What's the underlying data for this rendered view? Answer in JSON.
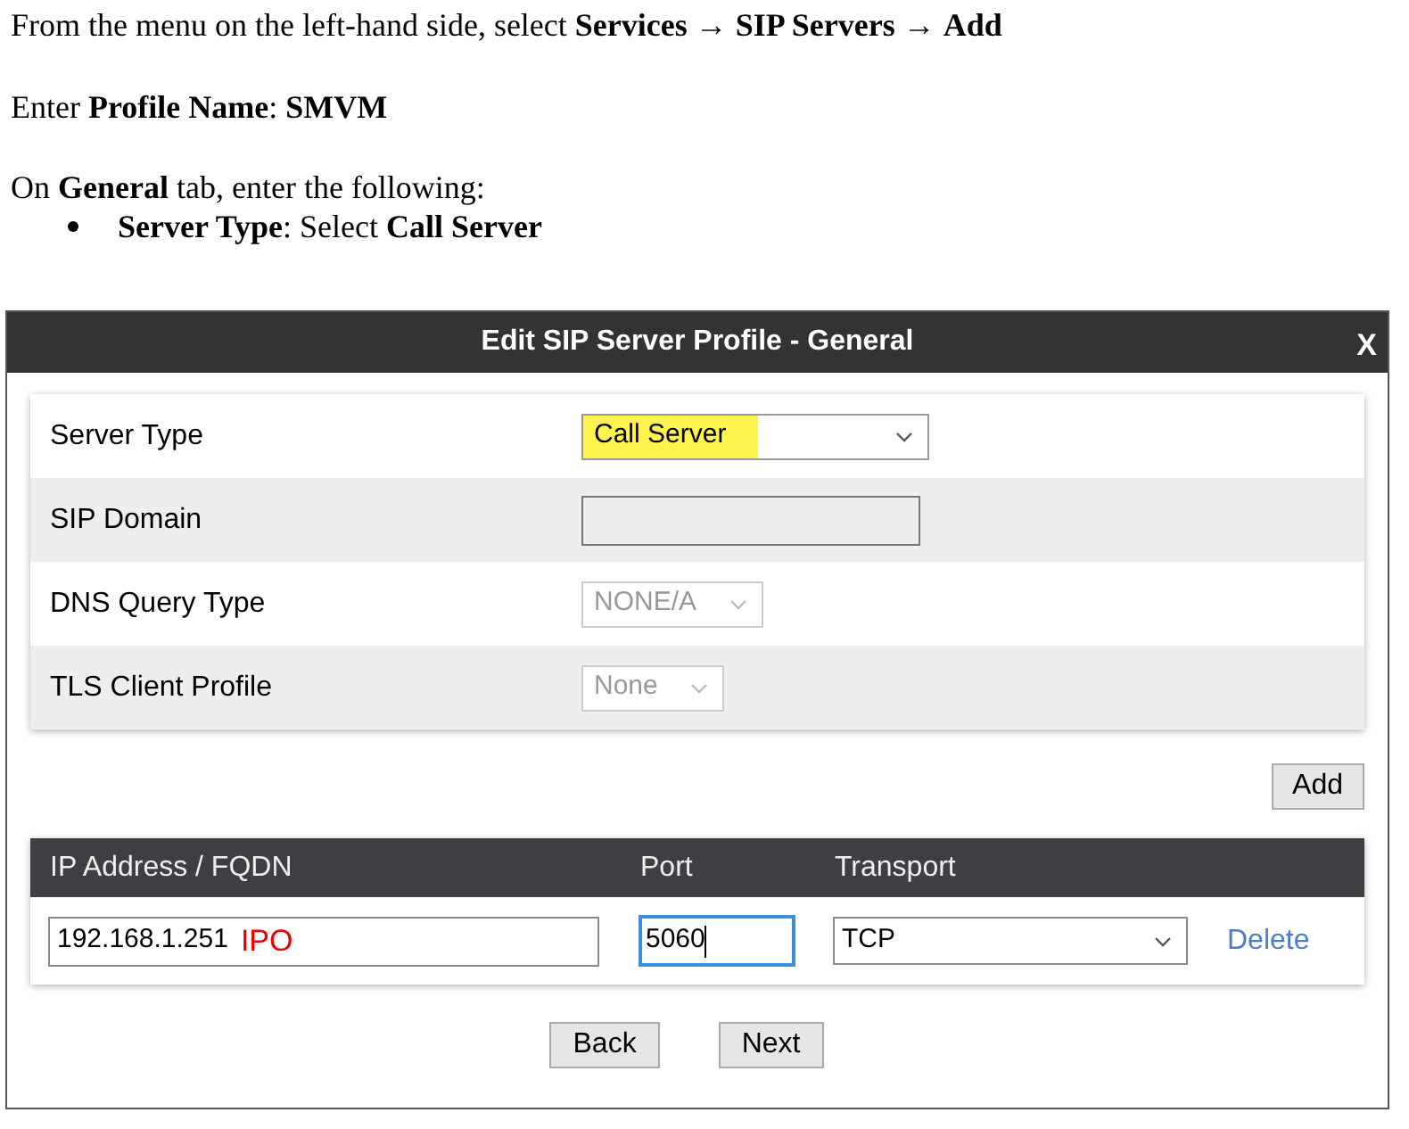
{
  "instructions": [
    "From the menu on the left-hand side, select **Services →** **SIP Servers →** **Add**",
    "Enter **Profile Name**: **SMVM**",
    "On **General** tab, enter the following:"
  ],
  "bullets": [
    "**Server Type**: Select **Call Server**"
  ],
  "dialog": {
    "title": "Edit SIP Server Profile - General",
    "close": "X",
    "fields": [
      {
        "label": "Server Type",
        "kind": "select",
        "value": "Call Server",
        "highlighted": true,
        "disabled": false
      },
      {
        "label": "SIP Domain",
        "kind": "text",
        "disabled": false
      },
      {
        "label": "DNS Query Type",
        "kind": "select",
        "value": "NONE/A",
        "highlighted": false,
        "disabled": true
      },
      {
        "label": "TLS Client Profile",
        "kind": "select",
        "value": "None",
        "highlighted": false,
        "disabled": true
      }
    ],
    "add_button": "Add",
    "table": {
      "columns": [
        "IP Address / FQDN",
        "Port",
        "Transport"
      ],
      "rows": [
        {
          "address": "192.168.1.251",
          "annotation": "IPO",
          "port": "5060",
          "port_focused": true,
          "transport": "TCP",
          "delete": "Delete"
        }
      ]
    },
    "buttons": [
      "Back",
      "Next"
    ]
  }
}
